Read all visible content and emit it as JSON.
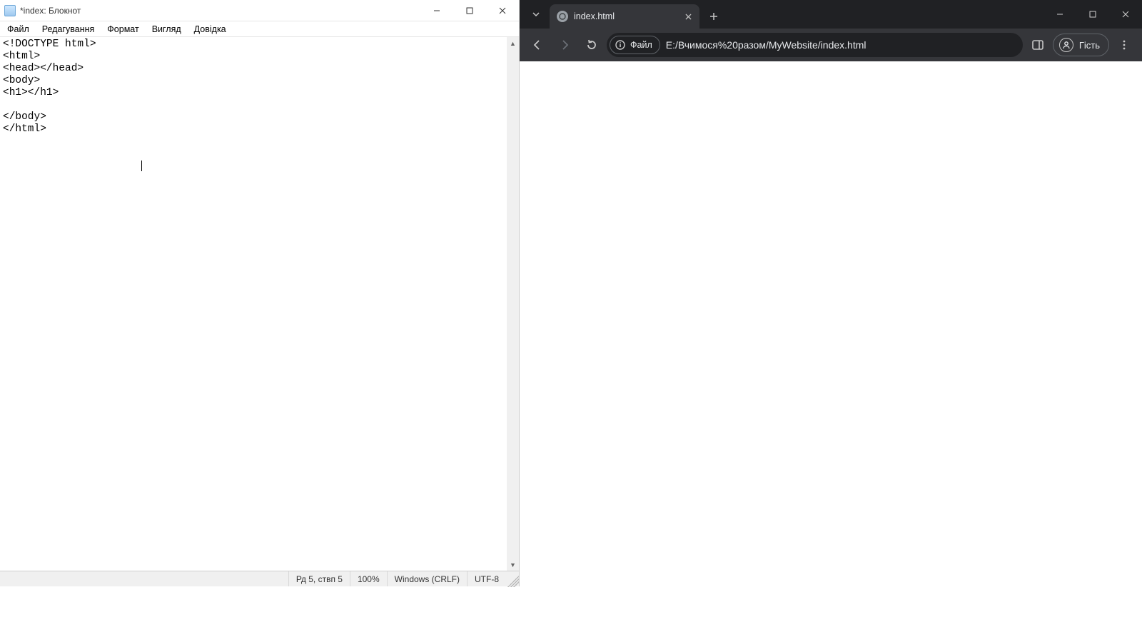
{
  "notepad": {
    "title": "*index: Блокнот",
    "menu": [
      "Файл",
      "Редагування",
      "Формат",
      "Вигляд",
      "Довідка"
    ],
    "content": "<!DOCTYPE html>\n<html>\n<head></head>\n<body>\n<h1></h1>\n\n</body>\n</html>",
    "status": {
      "position": "Рд 5, ствп 5",
      "zoom": "100%",
      "line_ending": "Windows (CRLF)",
      "encoding": "UTF-8"
    }
  },
  "chrome": {
    "tab_title": "index.html",
    "omnibox_chip": "Файл",
    "omnibox_url": "E:/Вчимося%20разом/MyWebsite/index.html",
    "profile_label": "Гість"
  }
}
